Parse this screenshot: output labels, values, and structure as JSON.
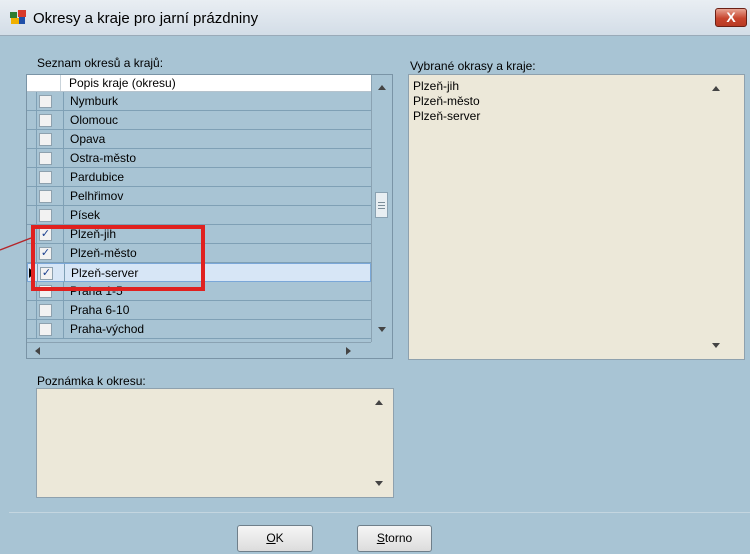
{
  "window": {
    "title": "Okresy a kraje pro jarní prázdniny",
    "close_label": "X"
  },
  "districts_panel": {
    "label": "Seznam okresů a krajů:",
    "column_header": "Popis kraje (okresu)",
    "rows": [
      {
        "label": "Nymburk",
        "checked": false
      },
      {
        "label": "Olomouc",
        "checked": false
      },
      {
        "label": "Opava",
        "checked": false
      },
      {
        "label": "Ostra-město",
        "checked": false
      },
      {
        "label": "Pardubice",
        "checked": false
      },
      {
        "label": "Pelhřimov",
        "checked": false
      },
      {
        "label": "Písek",
        "checked": false
      },
      {
        "label": "Plzeň-jih",
        "checked": true
      },
      {
        "label": "Plzeň-město",
        "checked": true
      },
      {
        "label": "Plzeň-server",
        "checked": true,
        "current": true
      },
      {
        "label": "Praha 1-5",
        "checked": false
      },
      {
        "label": "Praha 6-10",
        "checked": false
      },
      {
        "label": "Praha-východ",
        "checked": false
      }
    ]
  },
  "selected_panel": {
    "label": "Vybrané okrasy a kraje:",
    "items": [
      "Plzeň-jih",
      "Plzeň-město",
      "Plzeň-server"
    ]
  },
  "note_panel": {
    "label": "Poznámka  k okresu:",
    "value": ""
  },
  "buttons": {
    "ok_key": "O",
    "ok_rest": "K",
    "cancel_key": "S",
    "cancel_rest": "torno"
  },
  "colors": {
    "background": "#a8c4d4",
    "memo": "#ece8d9",
    "highlight": "#e0211f",
    "close": "#c7452e"
  }
}
